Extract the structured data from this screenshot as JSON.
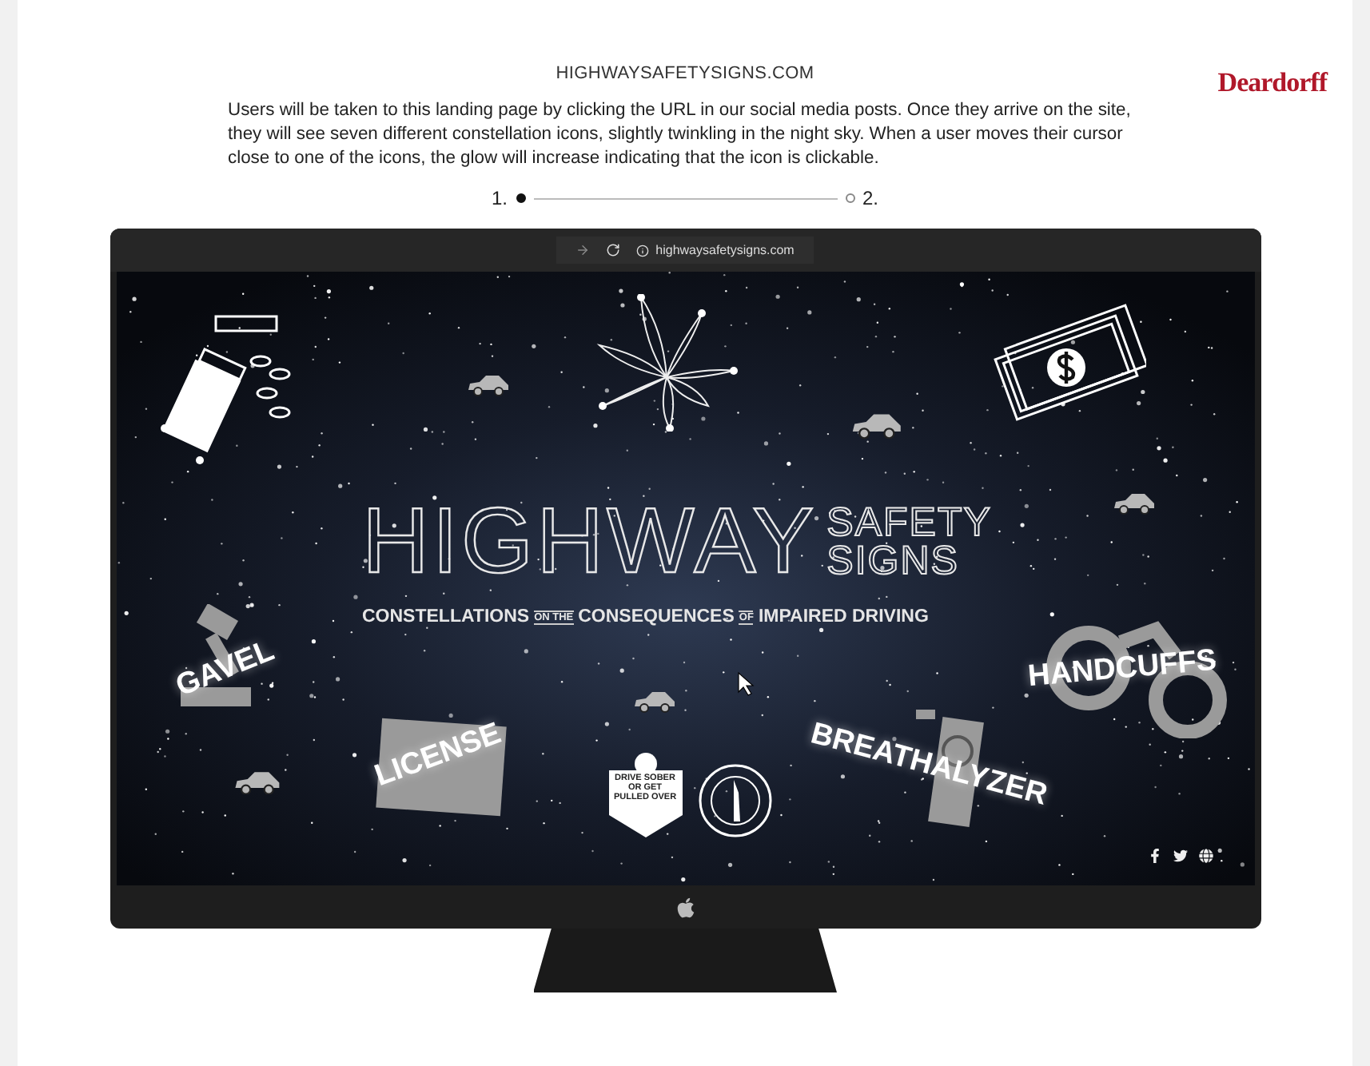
{
  "header": {
    "site": "HIGHWAYSAFETYSIGNS.COM",
    "brand": "Deardorff"
  },
  "description": "Users will be taken to this landing page by clicking the URL in our social media posts. Once they arrive on the site, they will see seven different constellation icons, slightly twinkling in the night sky. When a user moves their cursor close to one of the icons, the glow will increase indicating that the icon is clickable.",
  "steps": [
    {
      "label": "1.",
      "selected": true
    },
    {
      "label": "2.",
      "selected": false
    }
  ],
  "browser": {
    "url": "highwaysafetysigns.com"
  },
  "site": {
    "title": "HIGHWAY",
    "title_side": [
      "SAFETY",
      "SIGNS"
    ],
    "tagline": [
      {
        "text": "CONSTELLATIONS",
        "kind": "main"
      },
      {
        "text": "ON THE",
        "kind": "small"
      },
      {
        "text": "CONSEQUENCES",
        "kind": "main"
      },
      {
        "text": "OF",
        "kind": "small"
      },
      {
        "text": "IMPAIRED DRIVING",
        "kind": "main"
      }
    ],
    "constellations": [
      {
        "label": "GAVEL",
        "kind": "gavel"
      },
      {
        "label": "LICENSE",
        "kind": "license"
      },
      {
        "label": "BREATHALYZER",
        "kind": "breathalyzer"
      },
      {
        "label": "HANDCUFFS",
        "kind": "handcuffs"
      }
    ],
    "badge": "DRIVE SOBER OR GET PULLED OVER"
  }
}
